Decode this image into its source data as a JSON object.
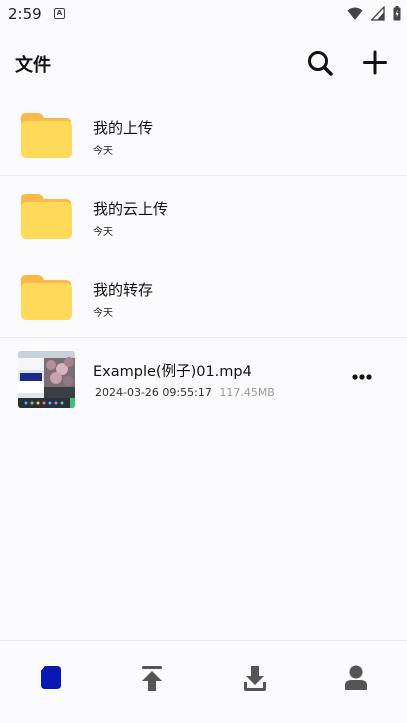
{
  "status_bar": {
    "time": "2:59",
    "notification_icon": "a-badge-icon"
  },
  "header": {
    "title": "文件",
    "search_icon": "search-icon",
    "add_icon": "plus-icon"
  },
  "folders": [
    {
      "name": "我的上传",
      "date": "今天",
      "icon": "folder-icon"
    },
    {
      "name": "我的云上传",
      "date": "今天",
      "icon": "folder-icon"
    },
    {
      "name": "我的转存",
      "date": "今天",
      "icon": "folder-icon"
    }
  ],
  "files": [
    {
      "name": "Example(例子)01.mp4",
      "date": "2024-03-26 09:55:17",
      "size": "117.45MB",
      "icon": "video-thumbnail"
    }
  ],
  "bottom_nav": {
    "items": [
      {
        "icon": "files-icon",
        "active": true
      },
      {
        "icon": "upload-icon",
        "active": false
      },
      {
        "icon": "download-icon",
        "active": false
      },
      {
        "icon": "profile-icon",
        "active": false
      }
    ]
  },
  "colors": {
    "background": "#fbfafd",
    "folder_front": "#ffd95a",
    "folder_back": "#fbb84b",
    "active_nav": "#0a18b3",
    "inactive_nav": "#555555",
    "divider": "#ececef"
  }
}
